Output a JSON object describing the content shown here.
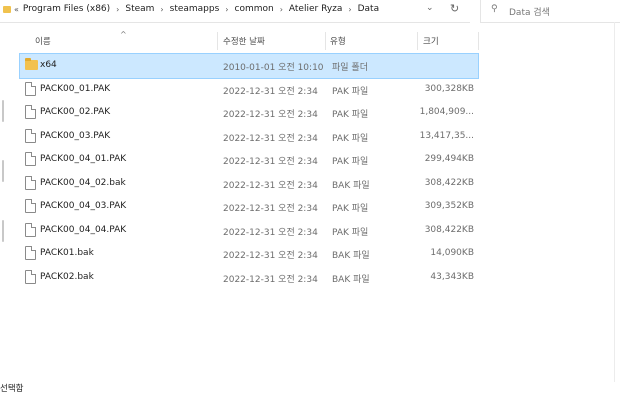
{
  "address": {
    "chevron": "«",
    "crumbs": [
      "Program Files (x86)",
      "Steam",
      "steamapps",
      "common",
      "Atelier Ryza",
      "Data"
    ],
    "dropdown_icon": "chevron-down",
    "refresh_icon": "refresh"
  },
  "search": {
    "placeholder": "Data 검색",
    "icon": "search"
  },
  "columns": {
    "name": "이름",
    "date": "수정한 날짜",
    "type": "유형",
    "size": "크기",
    "sort_indicator": "^"
  },
  "files": [
    {
      "name": "x64",
      "date": "2010-01-01 오전 10:10",
      "type": "파일 폴더",
      "size": "",
      "kind": "folder",
      "selected": true
    },
    {
      "name": "PACK00_01.PAK",
      "date": "2022-12-31 오전 2:34",
      "type": "PAK 파일",
      "size": "300,328KB",
      "kind": "file"
    },
    {
      "name": "PACK00_02.PAK",
      "date": "2022-12-31 오전 2:34",
      "type": "PAK 파일",
      "size": "1,804,909...",
      "kind": "file"
    },
    {
      "name": "PACK00_03.PAK",
      "date": "2022-12-31 오전 2:34",
      "type": "PAK 파일",
      "size": "13,417,35...",
      "kind": "file"
    },
    {
      "name": "PACK00_04_01.PAK",
      "date": "2022-12-31 오전 2:34",
      "type": "PAK 파일",
      "size": "299,494KB",
      "kind": "file"
    },
    {
      "name": "PACK00_04_02.bak",
      "date": "2022-12-31 오전 2:34",
      "type": "BAK 파일",
      "size": "308,422KB",
      "kind": "file"
    },
    {
      "name": "PACK00_04_03.PAK",
      "date": "2022-12-31 오전 2:34",
      "type": "PAK 파일",
      "size": "309,352KB",
      "kind": "file"
    },
    {
      "name": "PACK00_04_04.PAK",
      "date": "2022-12-31 오전 2:34",
      "type": "PAK 파일",
      "size": "308,422KB",
      "kind": "file"
    },
    {
      "name": "PACK01.bak",
      "date": "2022-12-31 오전 2:34",
      "type": "BAK 파일",
      "size": "14,090KB",
      "kind": "file"
    },
    {
      "name": "PACK02.bak",
      "date": "2022-12-31 오전 2:34",
      "type": "BAK 파일",
      "size": "43,343KB",
      "kind": "file"
    }
  ],
  "status": {
    "text": "선택함"
  },
  "colors": {
    "selection": "#cce8ff",
    "selection_border": "#99d1ff",
    "folder": "#f2c14e"
  }
}
